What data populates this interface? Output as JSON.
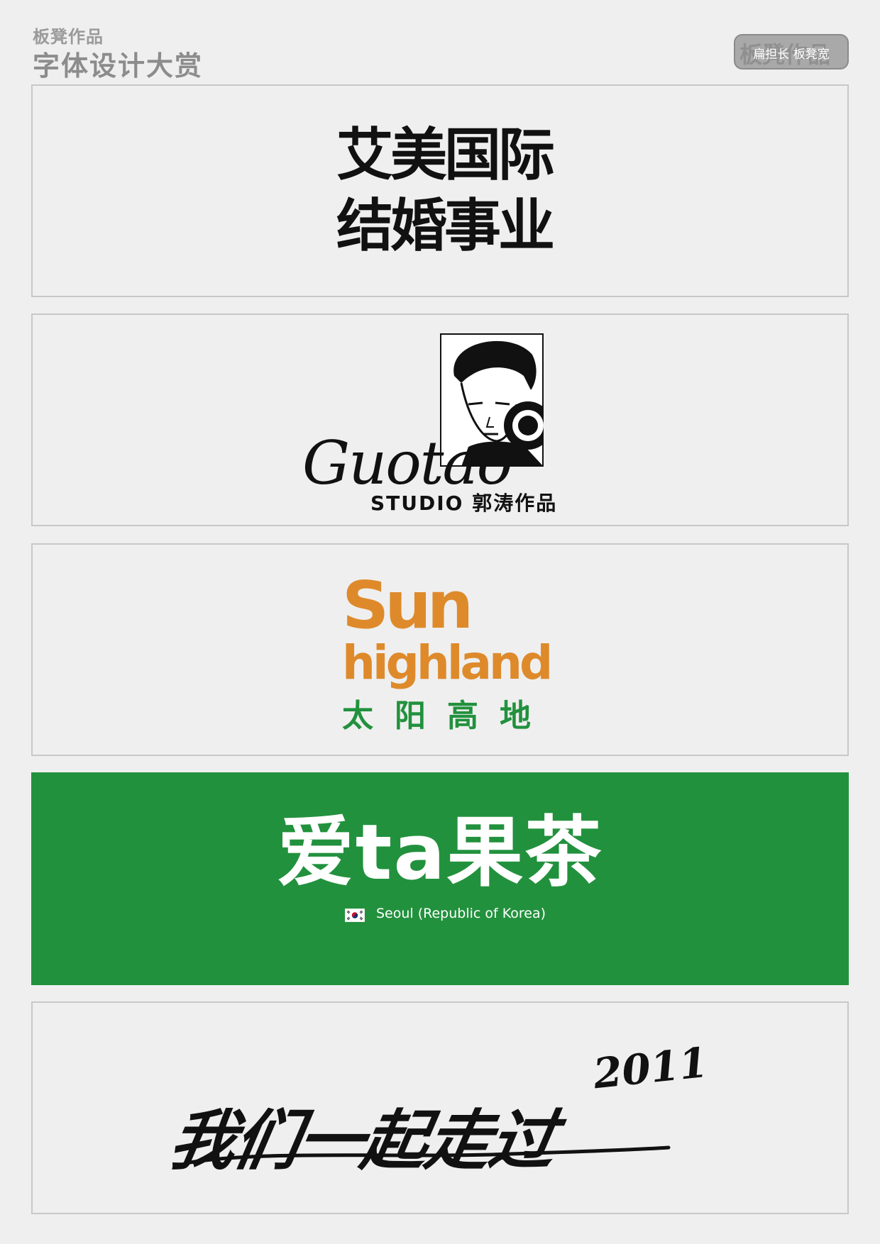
{
  "header": {
    "subtitle": "板凳作品",
    "title": "字体设计大赏"
  },
  "badge": {
    "background_text": "板凳作品",
    "label": "扁担长 板凳宽"
  },
  "panels": [
    {
      "lines": [
        "艾美国际",
        "结婚事业"
      ]
    },
    {
      "logo_script": "Guotao",
      "caption": "STUDIO 郭涛作品"
    },
    {
      "line1": "Sun",
      "line2": "highland",
      "line3": "太阳高地"
    },
    {
      "title": "爱ta果茶",
      "location": "Seoul (Republic of Korea)"
    },
    {
      "year": "2011",
      "slogan": "我们一起走过"
    }
  ],
  "colors": {
    "page_background": "#efefef",
    "panel_border": "#c8c8c8",
    "orange": "#de8a2b",
    "green": "#22913d",
    "black": "#111111"
  },
  "icons": {
    "flag": "korea-flag-icon",
    "portrait": "photographer-portrait"
  }
}
